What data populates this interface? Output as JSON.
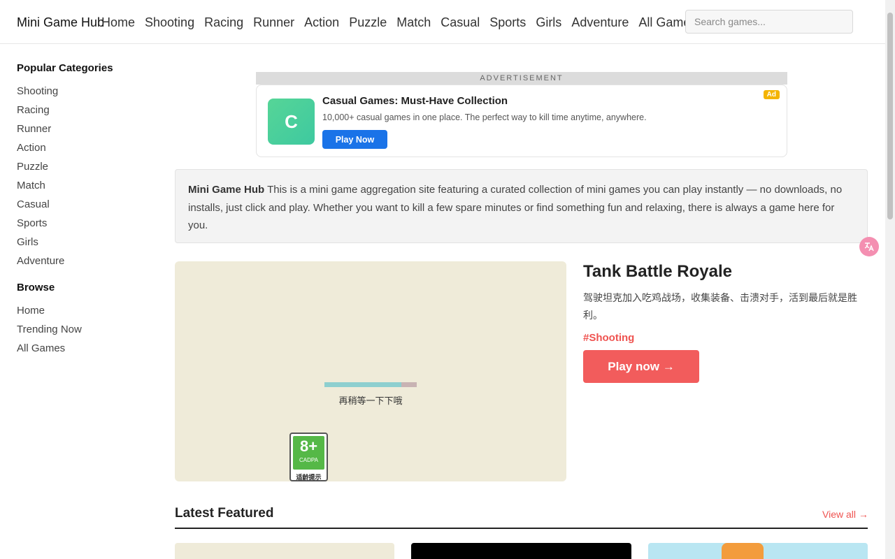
{
  "header": {
    "brand": "Mini Game Hub",
    "nav": [
      "Home",
      "Shooting",
      "Racing",
      "Runner",
      "Action",
      "Puzzle",
      "Match",
      "Casual",
      "Sports",
      "Girls",
      "Adventure",
      "All Games"
    ],
    "search_placeholder": "Search games..."
  },
  "sidebar": {
    "categories_heading": "Popular Categories",
    "categories": [
      "Shooting",
      "Racing",
      "Runner",
      "Action",
      "Puzzle",
      "Match",
      "Casual",
      "Sports",
      "Girls",
      "Adventure"
    ],
    "browse_heading": "Browse",
    "browse": [
      "Home",
      "Trending Now",
      "All Games"
    ]
  },
  "ad": {
    "label": "ADVERTISEMENT",
    "logo_letter": "C",
    "title": "Casual Games: Must-Have Collection",
    "description": "10,000+ casual games in one place. The perfect way to kill time anytime, anywhere.",
    "button": "Play Now",
    "badge": "Ad",
    "logo_color": "#4cd39b",
    "button_color": "#1a73e8"
  },
  "intro": {
    "brand": "Mini Game Hub",
    "text": " This is a mini game aggregation site featuring a curated collection of mini games you can play instantly — no downloads, no installs, just click and play. Whether you want to kill a few spare minutes or find something fun and relaxing, there is always a game here for you."
  },
  "featured": {
    "loading_text": "再稍等一下下哦",
    "loading_progress": 0.83,
    "age_rating": "8+",
    "age_org": "CADPA",
    "age_tip": "适龄提示",
    "title": "Tank Battle Royale",
    "description": "驾驶坦克加入吃鸡战场，收集装备、击溃对手，活到最后就是胜利。",
    "tag": "#Shooting",
    "play_button": "Play now →",
    "accent_color": "#f25c5c"
  },
  "latest": {
    "title": "Latest Featured",
    "view_all": "View all →"
  },
  "icons": {
    "translate": "translate-icon"
  }
}
